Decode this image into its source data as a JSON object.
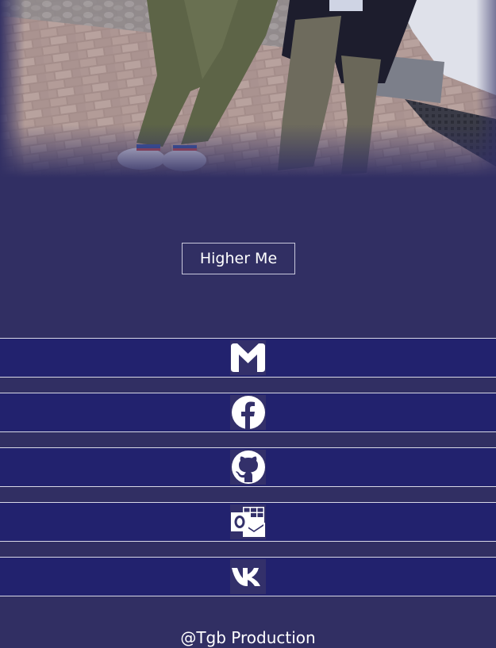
{
  "hero": {
    "image": "two-people-standing-on-brick-pavement-photo"
  },
  "title_button": {
    "label": "Higher Me"
  },
  "links": [
    {
      "icon": "gmail-icon",
      "service": "Gmail"
    },
    {
      "icon": "facebook-icon",
      "service": "Facebook"
    },
    {
      "icon": "github-icon",
      "service": "GitHub"
    },
    {
      "icon": "outlook-icon",
      "service": "Outlook"
    },
    {
      "icon": "vk-icon",
      "service": "VK"
    }
  ],
  "footer": {
    "text": "@Tgb Production"
  },
  "colors": {
    "page_background": "#312f63",
    "link_bar_background": "#22226e",
    "link_bar_border": "#d8d8e6",
    "text": "#ffffff"
  }
}
